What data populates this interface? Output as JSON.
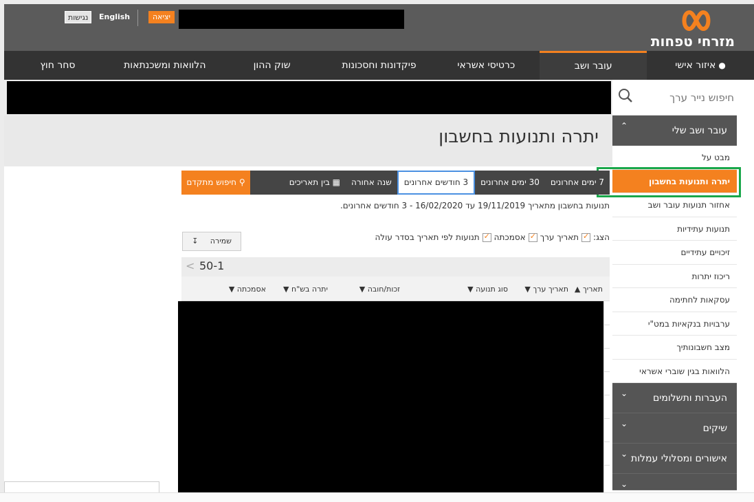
{
  "header": {
    "logo_text": "מזרחי טפחות",
    "accessibility": "נגישות",
    "english": "English",
    "logout": "יציאה"
  },
  "nav": {
    "items": [
      {
        "label": "איזור אישי"
      },
      {
        "label": "עובר ושב"
      },
      {
        "label": "כרטיסי אשראי"
      },
      {
        "label": "פיקדונות וחסכונות"
      },
      {
        "label": "שוק ההון"
      },
      {
        "label": "הלוואות ומשכנתאות"
      },
      {
        "label": "סחר חוץ"
      }
    ]
  },
  "sidebar": {
    "search_placeholder": "חיפוש נייר ערך",
    "group_current": "עובר ושב שלי",
    "items": [
      "מבט על",
      "יתרה ותנועות בחשבון",
      "אחזור תנועות עובר ושב",
      "תנועות עתידיות",
      "זיכויים עתידיים",
      "ריכוז יתרות",
      "עסקאות לחתימה",
      "ערבויות בנקאיות במט\"י",
      "מצב חשבונותיך",
      "הלוואות בגין שוברי אשראי"
    ],
    "groups": [
      "העברות ותשלומים",
      "שיקים",
      "אישורים ומסלולי עמלות"
    ]
  },
  "page": {
    "title": "יתרה ותנועות בחשבון"
  },
  "filters": {
    "items": [
      "7 ימים אחרונים",
      "30 ימים אחרונים",
      "3 חודשים אחרונים",
      "שנה אחורה",
      "בין תאריכים"
    ],
    "advanced_search": "חיפוש מתקדם"
  },
  "range_text": "תנועות בחשבון מתאריך 19/11/2019 עד 16/02/2020 - 3 חודשים אחרונים.",
  "show": {
    "label": "הצג:",
    "options": [
      "תאריך ערך",
      "אסמכתה",
      "תנועות לפי תאריך בסדר עולה"
    ]
  },
  "save_label": "שמירה",
  "pager": "50-1",
  "table": {
    "columns": [
      "תאריך",
      "תאריך ערך",
      "סוג תנועה",
      "זכות/חובה",
      "יתרה בש\"ח",
      "אסמכתה"
    ]
  }
}
